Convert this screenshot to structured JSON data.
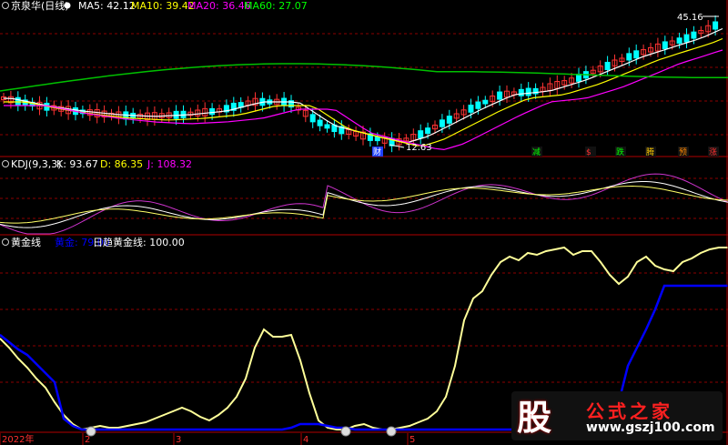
{
  "panel1": {
    "title": "京泉华(日线)",
    "indicators": [
      {
        "label": "MA5: 42.12",
        "color": "#ffffff"
      },
      {
        "label": "MA10: 39.42",
        "color": "#ffff00"
      },
      {
        "label": "MA20: 36.46",
        "color": "#ff00ff"
      },
      {
        "label": "MA60: 27.07",
        "color": "#00ff00"
      }
    ],
    "price_high_label": "45.16",
    "price_low_label": "12.63",
    "marker_cai": "财",
    "event_tags": [
      {
        "text": "减",
        "color": "#00ff00"
      },
      {
        "text": "$",
        "color": "#ff3030"
      },
      {
        "text": "跌",
        "color": "#00ff00"
      },
      {
        "text": "腾",
        "color": "#ffcc00"
      },
      {
        "text": "预",
        "color": "#ff8800"
      },
      {
        "text": "涨",
        "color": "#ff3030"
      }
    ]
  },
  "panel2": {
    "title": "KDJ(9,3,3)",
    "indicators": [
      {
        "label": "K: 93.67",
        "color": "#ffffff"
      },
      {
        "label": "D: 86.35",
        "color": "#ffff00"
      },
      {
        "label": "J: 108.32",
        "color": "#ff00ff"
      }
    ]
  },
  "panel3": {
    "title": "黄金线",
    "indicators": [
      {
        "label": "黄金: 79.00",
        "color": "#0000ff"
      },
      {
        "label": "日趋黄金线: 100.00",
        "color": "#ffffff"
      }
    ]
  },
  "x_axis": {
    "labels": [
      "2022年",
      "2",
      "3",
      "4",
      "5"
    ]
  },
  "watermark": {
    "big": "股",
    "title": "公式之家",
    "url": "www.gszj100.com"
  },
  "colors": {
    "up": "#ff3333",
    "down": "#00ffff",
    "grid": "#8b0000",
    "gold": "#ffff99",
    "blue": "#0000ff"
  },
  "chart_data": [
    {
      "type": "candlestick",
      "title": "京泉华(日线)",
      "series": [
        {
          "name": "MA5",
          "values": [
            42.12
          ]
        },
        {
          "name": "MA10",
          "values": [
            39.42
          ]
        },
        {
          "name": "MA20",
          "values": [
            36.46
          ]
        },
        {
          "name": "MA60",
          "values": [
            27.07
          ]
        }
      ],
      "annotations": [
        {
          "text": "45.16",
          "type": "high"
        },
        {
          "text": "12.63",
          "type": "low"
        }
      ]
    },
    {
      "type": "line",
      "title": "KDJ(9,3,3)",
      "series": [
        {
          "name": "K",
          "last": 93.67
        },
        {
          "name": "D",
          "last": 86.35
        },
        {
          "name": "J",
          "last": 108.32
        }
      ]
    },
    {
      "type": "line",
      "title": "黄金线",
      "ylim": [
        0,
        100
      ],
      "x": [
        0,
        10,
        20,
        30,
        40,
        50,
        60,
        70,
        80,
        90,
        100,
        110,
        120,
        130,
        140,
        150,
        160,
        170,
        180,
        190,
        200,
        210,
        220,
        230,
        240,
        250,
        260,
        270,
        280,
        290,
        300,
        310,
        320,
        330,
        340,
        350,
        360,
        370,
        380,
        390,
        400,
        410,
        420,
        430,
        440,
        450,
        460,
        470,
        480,
        490,
        500,
        510,
        520,
        530,
        540,
        550,
        560,
        570,
        580,
        590,
        600,
        610,
        620,
        630,
        640,
        650,
        660,
        670,
        680,
        690,
        700,
        710,
        720,
        730,
        740,
        750,
        760,
        770,
        780,
        790,
        799
      ],
      "series": [
        {
          "name": "日趋黄金线",
          "values": [
            50,
            45,
            39,
            34,
            28,
            23,
            15,
            8,
            3,
            0,
            1,
            2,
            1,
            1,
            2,
            3,
            4,
            6,
            8,
            10,
            12,
            10,
            7,
            5,
            8,
            12,
            18,
            28,
            45,
            55,
            51,
            51,
            52,
            38,
            20,
            5,
            1,
            0,
            0,
            2,
            3,
            1,
            0,
            0,
            1,
            2,
            4,
            6,
            10,
            18,
            35,
            60,
            72,
            76,
            85,
            92,
            95,
            93,
            97,
            96,
            98,
            99,
            100,
            96,
            98,
            98,
            92,
            85,
            80,
            84,
            92,
            95,
            90,
            88,
            87,
            92,
            94,
            97,
            99,
            100,
            100
          ]
        },
        {
          "name": "黄金",
          "values": [
            52,
            48,
            44,
            41,
            36,
            31,
            26,
            6,
            2,
            0,
            0,
            0,
            0,
            0,
            0,
            0,
            0,
            0,
            0,
            0,
            0,
            0,
            0,
            0,
            0,
            0,
            0,
            0,
            0,
            0,
            0,
            0,
            1,
            3,
            3,
            3,
            2,
            1,
            1,
            0,
            0,
            0,
            0,
            0,
            0,
            0,
            0,
            0,
            0,
            0,
            0,
            0,
            0,
            0,
            0,
            0,
            0,
            0,
            0,
            0,
            0,
            0,
            0,
            0,
            0,
            0,
            0,
            0,
            15,
            35,
            45,
            55,
            66,
            79,
            79,
            79,
            79,
            79,
            79,
            79,
            79
          ]
        }
      ]
    }
  ]
}
